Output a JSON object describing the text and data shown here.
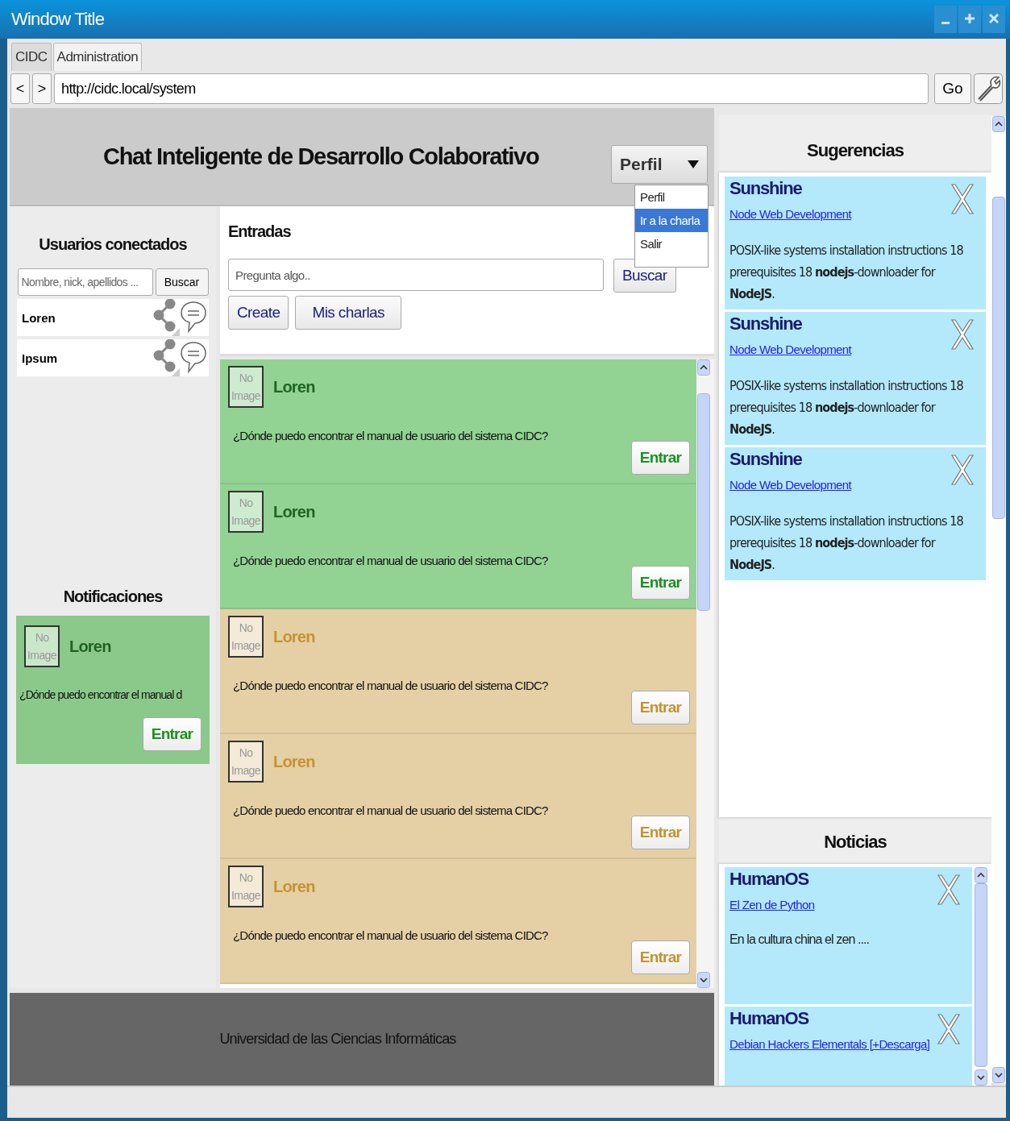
{
  "window": {
    "title": "Window Title"
  },
  "tabs": [
    {
      "label": "CIDC",
      "selected": false
    },
    {
      "label": "Administration",
      "selected": true
    }
  ],
  "address_bar": {
    "back": "<",
    "forward": ">",
    "url": "http://cidc.local/system",
    "go": "Go"
  },
  "header": {
    "title": "Chat Inteligente de Desarrollo Colaborativo",
    "profile_button": "Perfil",
    "profile_menu": [
      {
        "label": "Perfil",
        "selected": false
      },
      {
        "label": "Ir a la charla",
        "selected": true
      },
      {
        "label": "Salir",
        "selected": false
      }
    ]
  },
  "users": {
    "title": "Usuarios conectados",
    "search": {
      "placeholder": "Nombre, nick, apellidos ..."
    },
    "search_button": "Buscar",
    "items": [
      {
        "name": "Loren"
      },
      {
        "name": "Ipsum"
      }
    ]
  },
  "notifications": {
    "title": "Notificaciones",
    "items": [
      {
        "color": "#8bc98b",
        "avatar": "No Image",
        "name": "Loren",
        "text": "¿Dónde puedo encontrar el manual d",
        "button": "Entrar"
      }
    ]
  },
  "entries": {
    "title": "Entradas",
    "search": {
      "placeholder": "Pregunta algo.."
    },
    "search_button": "Buscar",
    "buttons": [
      "Create",
      "Mis charlas"
    ],
    "items": [
      {
        "color": "#92d394",
        "avatar": "No Image",
        "name": "Loren",
        "text": "¿Dónde puedo encontrar el manual de usuario del sistema CIDC?",
        "button": "Entrar"
      },
      {
        "color": "#92d394",
        "avatar": "No Image",
        "name": "Loren",
        "text": "¿Dónde puedo encontrar el manual de usuario del sistema CIDC?",
        "button": "Entrar"
      },
      {
        "color": "#e5d0a6",
        "avatar": "No Image",
        "name": "Loren",
        "text": "¿Dónde puedo encontrar el manual de usuario del sistema CIDC?",
        "button": "Entrar"
      },
      {
        "color": "#e5d0a6",
        "avatar": "No Image",
        "name": "Loren",
        "text": "¿Dónde puedo encontrar el manual de usuario del sistema CIDC?",
        "button": "Entrar"
      },
      {
        "color": "#e5d0a6",
        "avatar": "No Image",
        "name": "Loren",
        "text": "¿Dónde puedo encontrar el manual de usuario del sistema CIDC?",
        "button": "Entrar"
      }
    ]
  },
  "footer": {
    "text": "Universidad de las Ciencias Informáticas"
  },
  "suggestions": {
    "title": "Sugerencias",
    "items": [
      {
        "title": "Sunshine",
        "link": "Node Web Development",
        "text": "POSIX-like systems installation instructions 18 prerequisites 18 **nodejs**-downloader for **NodeJS**."
      },
      {
        "title": "Sunshine",
        "link": "Node Web Development",
        "text": "POSIX-like systems installation instructions 18 prerequisites 18 **nodejs**-downloader for **NodeJS**."
      },
      {
        "title": "Sunshine",
        "link": "Node Web Development",
        "text": "POSIX-like systems installation instructions 18 prerequisites 18 **nodejs**-downloader for **NodeJS**."
      }
    ]
  },
  "news": {
    "title": "Noticias",
    "items": [
      {
        "title": "HumanOS",
        "link": "El Zen de Python",
        "text": "En la cultura china el zen ...."
      },
      {
        "title": "HumanOS",
        "link": "Debian Hackers Elementals [+Descarga]"
      }
    ]
  }
}
